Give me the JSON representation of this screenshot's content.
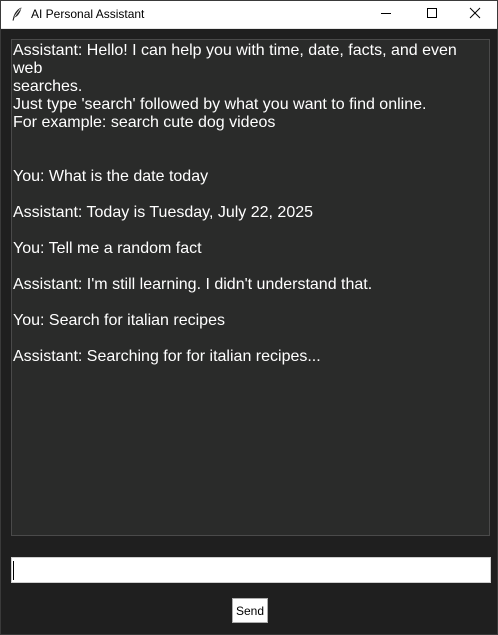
{
  "window": {
    "title": "AI Personal Assistant",
    "icons": {
      "app": "feather-icon",
      "minimize": "minimize-icon",
      "maximize": "maximize-icon",
      "close": "close-icon"
    }
  },
  "chat": {
    "lines": [
      "Assistant: Hello! I can help you with time, date, facts, and even web",
      "searches.",
      "Just type 'search' followed by what you want to find online.",
      "For example: search cute dog videos",
      "",
      "",
      "You: What is the date today",
      "",
      "Assistant: Today is Tuesday, July 22, 2025",
      "",
      "You: Tell me a random fact",
      "",
      "Assistant: I'm still learning. I didn't understand that.",
      "",
      "You: Search for italian recipes",
      "",
      "Assistant: Searching for for italian recipes..."
    ]
  },
  "input": {
    "value": "",
    "placeholder": ""
  },
  "send": {
    "label": "Send"
  },
  "colors": {
    "window_bg": "#1f1f1f",
    "chat_bg": "#2a2b2a",
    "chat_text": "#ffffff",
    "titlebar_bg": "#ffffff"
  }
}
